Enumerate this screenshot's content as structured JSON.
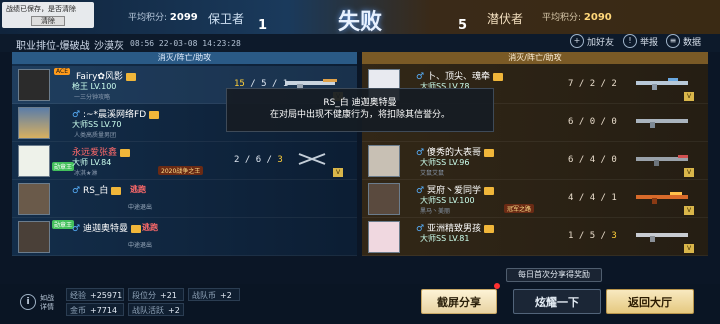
{
  "notice": {
    "text": "战绩已保存，是否清除",
    "clear_label": "清除"
  },
  "header": {
    "left_avg_label": "平均积分:",
    "left_avg_value": "2099",
    "left_team": "保卫者",
    "left_score": "1",
    "result": "失败",
    "right_score": "5",
    "right_team": "潜伏者",
    "right_avg_label": "平均积分:",
    "right_avg_value": "2090"
  },
  "subbar": {
    "mode": "职业排位-爆破战",
    "map": "沙漠灰",
    "time": "08:56  22-03-08 14:23:28",
    "actions": [
      {
        "label": "加好友",
        "icon": "add-friend-icon"
      },
      {
        "label": "举报",
        "icon": "report-icon"
      },
      {
        "label": "数据",
        "icon": "data-icon"
      }
    ]
  },
  "left_team": {
    "column_header": "消灭/阵亡/助攻",
    "players": [
      {
        "name": "Fairy✿风影",
        "rank": "枪王 LV.100",
        "clan": "一三分钟攻略",
        "kda": [
          "15",
          "5",
          "1"
        ],
        "tag": "ACE"
      },
      {
        "name": ":~*晨溪网络FD",
        "rank": "大师SS LV.70",
        "clan": "人类高质量男团",
        "kda": [
          "",
          "",
          ""
        ]
      },
      {
        "name": "永远爱张鑫",
        "rank": "大师 LV.84",
        "clan": "冰淇★淋",
        "kda": [
          "2",
          "6",
          "3"
        ],
        "tag": "勋章王",
        "title": "2020战争之王"
      },
      {
        "name": "RS_白",
        "rank": "",
        "clan": "",
        "kda": [
          "",
          "",
          ""
        ],
        "leave": "逃跑",
        "leave_sub": "中途退出"
      },
      {
        "name": "迪迦奥特曼",
        "rank": "",
        "clan": "",
        "kda": [
          "",
          "",
          ""
        ],
        "leave": "逃跑",
        "leave_sub": "中途退出",
        "tag": "勋章王"
      }
    ]
  },
  "right_team": {
    "column_header": "消灭/阵亡/助攻",
    "players": [
      {
        "name": "卜、顶尖、魂牵",
        "rank": "大师SS LV.78",
        "clan": "",
        "kda": [
          "7",
          "2",
          "2"
        ]
      },
      {
        "name": "",
        "rank": "",
        "clan": "",
        "kda": [
          "6",
          "0",
          "0"
        ]
      },
      {
        "name": "傻秀的大表哥",
        "rank": "大师SS LV.96",
        "clan": "艾鼠艾鼠",
        "kda": [
          "6",
          "4",
          "0"
        ]
      },
      {
        "name": "冥府丶爱同学",
        "rank": "大师SS LV.100",
        "clan": "黑马丶美丽",
        "kda": [
          "4",
          "4",
          "1"
        ],
        "title": "冠军之路"
      },
      {
        "name": "亚洲精致男孩",
        "rank": "大师SS LV.81",
        "clan": "",
        "kda": [
          "1",
          "5",
          "3"
        ]
      }
    ]
  },
  "kick_notice": {
    "line1": "RS_白 迪迦奥特曼",
    "line2": "在对局中出现不健康行为，将扣除其信誉分。"
  },
  "footer": {
    "detail_label": "如战详情",
    "stats": [
      {
        "label": "经验",
        "value": "+25971"
      },
      {
        "label": "段位分",
        "value": "+21"
      },
      {
        "label": "战队币",
        "value": "+2"
      },
      {
        "label": "金币",
        "value": "+7714"
      },
      {
        "label": "战队活跃",
        "value": "+2"
      }
    ],
    "share_hint": "每日首次分享得奖励",
    "btn_share": "截屏分享",
    "btn_brag": "炫耀一下",
    "btn_lobby": "返回大厅"
  },
  "colors": {
    "left_team": "#2a5a86",
    "right_team": "#7a5a26",
    "highlight": "#ffcf3a",
    "leave": "#ff6a6a"
  }
}
